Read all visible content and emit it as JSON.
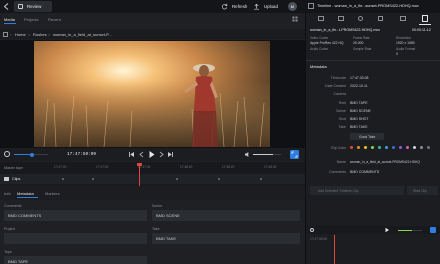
{
  "topbar": {
    "review_label": "Review",
    "refresh_label": "Refresh",
    "upload_label": "Upload",
    "user_initial": "M"
  },
  "tabs": [
    "Media",
    "Projects",
    "Recent"
  ],
  "breadcrumb": {
    "home": "Home",
    "sep1": ">",
    "folder": "Rushes",
    "sep2": ">",
    "file": "woman_in_a_field_at_sunset-P..."
  },
  "transport": {
    "timecode": "17:47:50:09"
  },
  "timeline": {
    "track_label": "Master tape",
    "clips_label": "Clips",
    "ticks": [
      "17:47:00",
      "17:47:20",
      "17:47:40",
      "17:48:00",
      "17:48:20",
      "17:48:40"
    ]
  },
  "meta_tabs": [
    "Info",
    "Metadata",
    "Markers"
  ],
  "metadata_form": {
    "comments_label": "Comments",
    "comments_value": "BMD COMMENTS",
    "scene_label": "Scene",
    "scene_value": "BMD SCENE",
    "project_label": "Project",
    "project_value": "",
    "take_label": "Take",
    "take_value": "BMD TAKE",
    "bottom_label": "Tape",
    "bottom_value": "BMD TAPE"
  },
  "right_panel": {
    "title": "Timeline - woman_in_a_fie...sunset-PROMS422-HDHQ.mov",
    "subtitle": "woman_in_a_fie...t-PROMS422-HDHQ.mov",
    "duration": "00:00:11:12",
    "info": [
      {
        "label": "Video Codec",
        "value": "Apple ProRes 422 HQ"
      },
      {
        "label": "Frame Rate",
        "value": "25.000"
      },
      {
        "label": "Resolution",
        "value": "1920 x 1080"
      },
      {
        "label": "Audio Codec",
        "value": ""
      },
      {
        "label": "Sample Rate",
        "value": ""
      },
      {
        "label": "Audio Format",
        "value": "0"
      }
    ],
    "metadata_heading": "Metadata",
    "metadata": [
      {
        "label": "Timecode",
        "value": "17:47:33:08"
      },
      {
        "label": "Date Created",
        "value": "2022-10-11"
      },
      {
        "label": "Camera",
        "value": ""
      },
      {
        "label": "Reel",
        "value": "BMD TAPE"
      },
      {
        "label": "Scene",
        "value": "BMD SCENE"
      },
      {
        "label": "Shot",
        "value": "BMD SHOT"
      },
      {
        "label": "Take",
        "value": "BMD TAKE"
      }
    ],
    "good_take": "Good Take",
    "clip_color_label": "Clip Color",
    "clip_colors": [
      "#e0463d",
      "#e88b2e",
      "#e8c52e",
      "#8bd44a",
      "#3db5a2",
      "#3da0e0",
      "#4a66d9",
      "#8b5fd4",
      "#d45fb5",
      "#d4d4d4",
      "#8a8f97",
      "#6e7379"
    ],
    "name_label": "Name",
    "name_value": "woman_in_a_field_at_sunset-PROMS422-HDHQ",
    "comments_label": "Comments",
    "comments_value": "BMD COMMENTS",
    "action_left": "Add Selected Timeline Clip",
    "action_right": "Start Clip",
    "player_time": "17:47:33:08"
  },
  "colors": {
    "accent": "#2f7de1",
    "playhead": "#e0463d"
  }
}
